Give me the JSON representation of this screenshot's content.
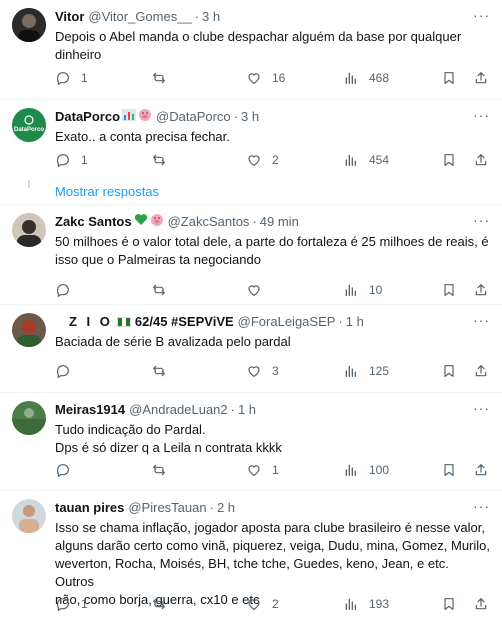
{
  "tweets": [
    {
      "name": "Vitor",
      "handle": "@Vitor_Gomes__",
      "time": "3 h",
      "text": [
        "Depois o Abel manda o clube despachar alguém da base por qualquer",
        "dinheiro"
      ],
      "replies": "1",
      "retweets": "",
      "likes": "16",
      "views": "468"
    },
    {
      "name": "DataPorco",
      "handle": "@DataPorco",
      "time": "3 h",
      "avatar_text": "DataPorco",
      "text": [
        "Exato.. a conta precisa fechar."
      ],
      "replies": "1",
      "retweets": "",
      "likes": "2",
      "views": "454"
    },
    {
      "name": "Zakc Santos",
      "handle": "@ZakcSantos",
      "time": "49 min",
      "text": [
        "50 milhoes é o valor total dele, a parte do fortaleza é 25 milhoes de reais, é",
        "isso que o Palmeiras ta negociando"
      ],
      "replies": "",
      "retweets": "",
      "likes": "",
      "views": "10"
    },
    {
      "name_prefix": "Z I O",
      "name": "62/45 #SEPViVE",
      "handle": "@ForaLeigaSEP",
      "time": "1 h",
      "text": [
        "Baciada de série B avalizada pelo pardal"
      ],
      "replies": "",
      "retweets": "",
      "likes": "3",
      "views": "125"
    },
    {
      "name": "Meiras1914",
      "handle": "@AndradeLuan2",
      "time": "1 h",
      "text": [
        "Tudo indicação do Pardal.",
        "Dps é só dizer q a Leila n contrata kkkk"
      ],
      "replies": "",
      "retweets": "",
      "likes": "1",
      "views": "100"
    },
    {
      "name": "tauan pires",
      "handle": "@PiresTauan",
      "time": "2 h",
      "text": [
        "Isso se chama inflação, jogador aposta para clube brasileiro é nesse valor,",
        "alguns darão certo como vinã, piquerez, veiga, Dudu, mina, Gomez, Murilo,",
        "weverton, Rocha, Moisés, BH, tche tche, Guedes, keno, Jean, e etc. Outros",
        "não, como borja, guerra, cx10 e etc"
      ],
      "replies": "1",
      "retweets": "",
      "likes": "2",
      "views": "193"
    }
  ],
  "show_replies_label": "Mostrar respostas",
  "more_label": "···",
  "dot": "·",
  "colors": {
    "accent": "#1d9bf0",
    "muted": "#536471",
    "text": "#0f1419",
    "divider": "#eff3f4",
    "datap_bg": "#1f8a4c"
  }
}
